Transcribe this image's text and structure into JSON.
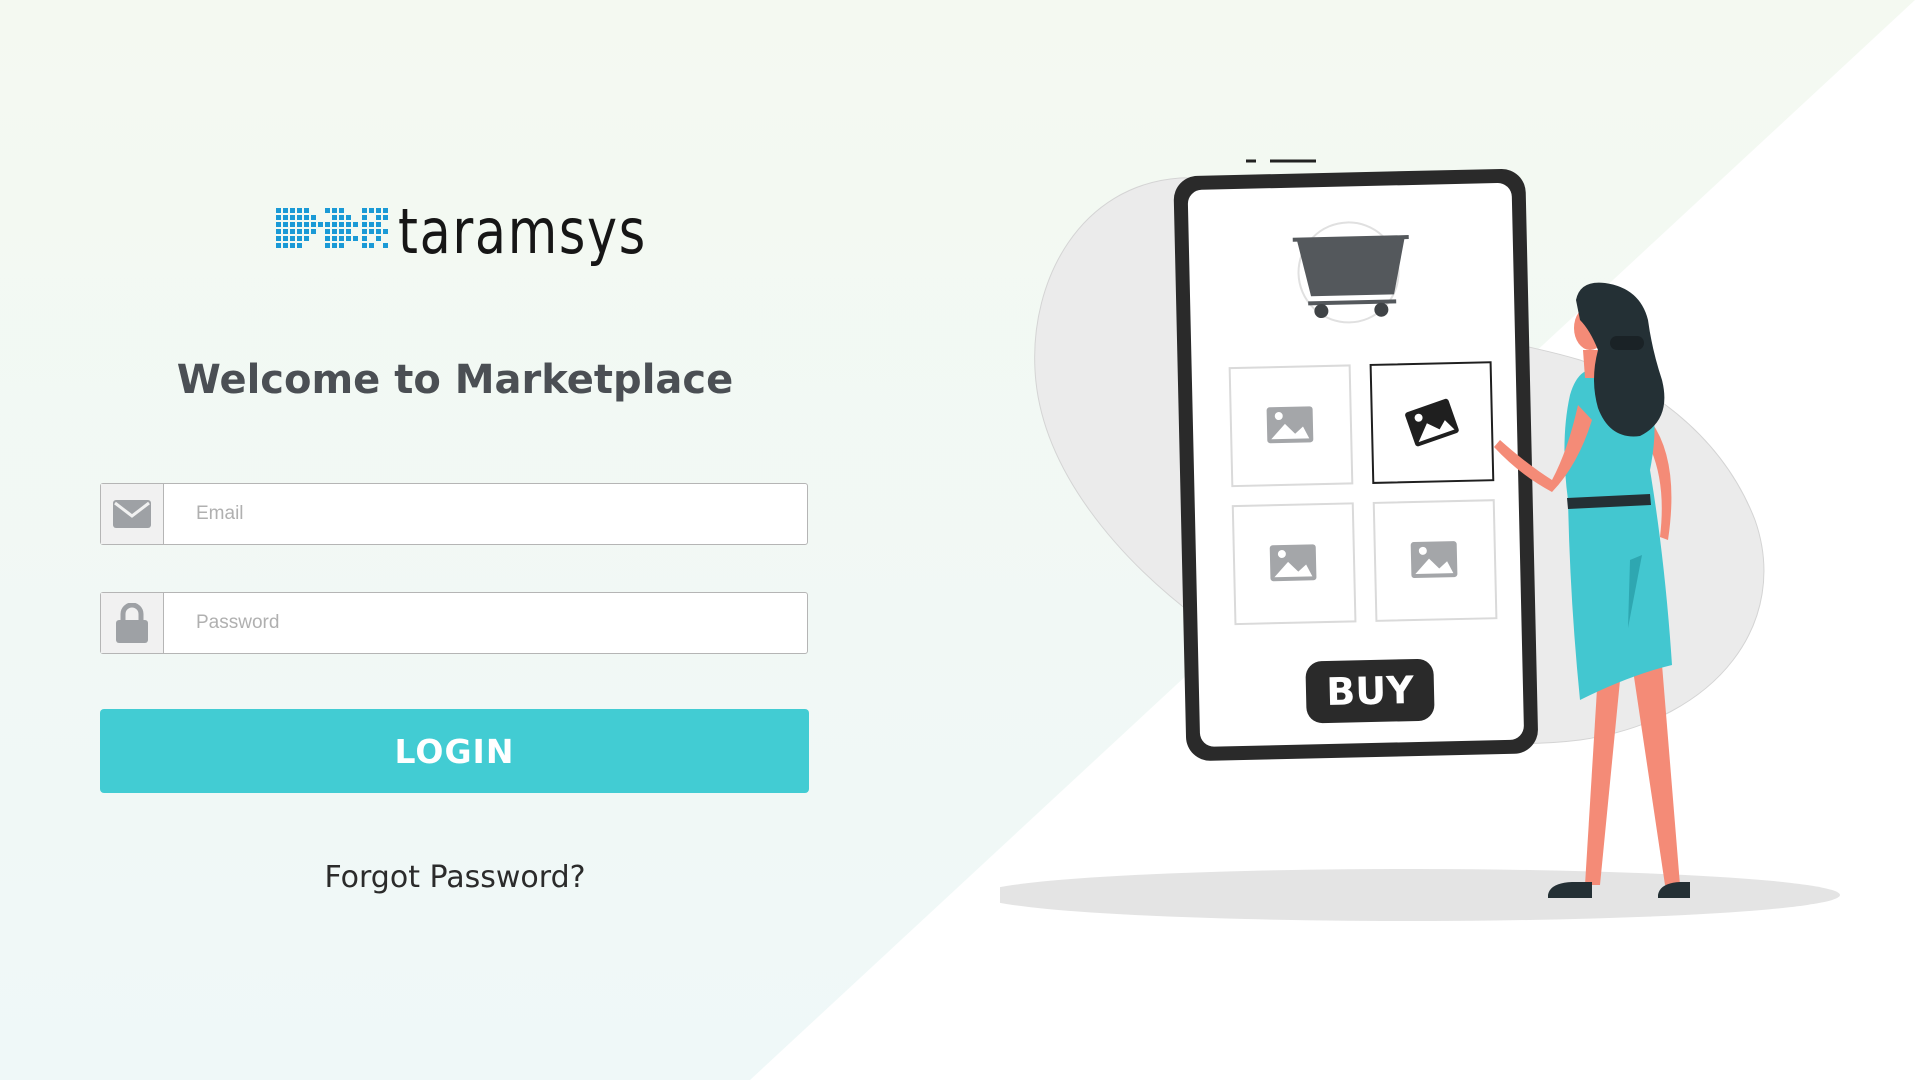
{
  "brand": {
    "name": "taramsys",
    "accent": "#1a9ad6"
  },
  "login": {
    "title": "Welcome to Marketplace",
    "email_placeholder": "Email",
    "password_placeholder": "Password",
    "login_label": "LOGIN",
    "forgot_label": "Forgot Password?",
    "accent_color": "#42ccd3"
  },
  "illustration": {
    "buy_label": "BUY",
    "icons": [
      "shopping-cart-icon",
      "image-placeholder-icon"
    ]
  }
}
